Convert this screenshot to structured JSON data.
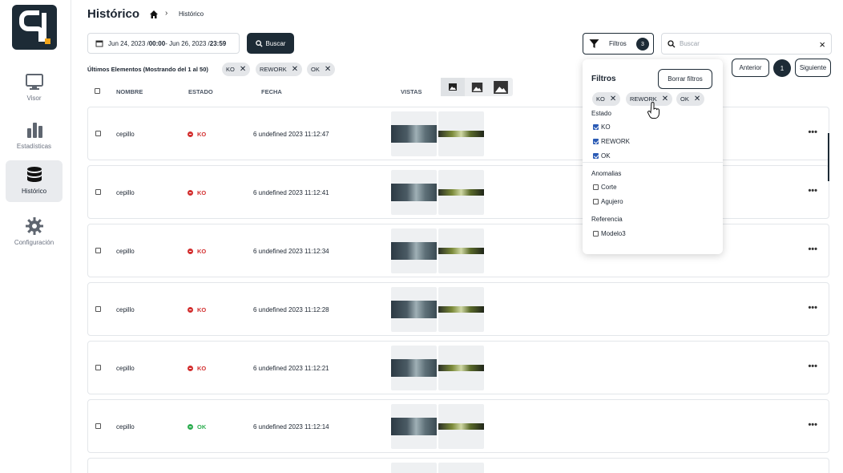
{
  "sidebar": {
    "items": [
      {
        "label": "Visor",
        "icon": "monitor-icon"
      },
      {
        "label": "Estadísticas",
        "icon": "bar-chart-icon"
      },
      {
        "label": "Histórico",
        "icon": "database-icon",
        "active": true
      },
      {
        "label": "Configuración",
        "icon": "gear-icon"
      }
    ]
  },
  "header": {
    "title": "Histórico",
    "breadcrumb_current": "Histórico"
  },
  "toolbar": {
    "date_range": "Jun 24, 2023 / 00:00 - Jun 26, 2023 / 23:59",
    "date_start": "Jun 24, 2023 / ",
    "date_start_time": "00:00",
    "date_mid": " - Jun 26, 2023 / ",
    "date_end_time": "23:59",
    "buscar_label": "Buscar",
    "filtros_label": "Filtros",
    "filtros_count": "3",
    "search_placeholder": "Buscar"
  },
  "summary": "Últimos Elementos (Mostrando del 1 al 50)",
  "active_chips": [
    "KO",
    "REWORK",
    "OK"
  ],
  "pagination": {
    "prev_label": "Anterior",
    "page": "1",
    "next_label": "Siguiente"
  },
  "table": {
    "headers": {
      "nombre": "NOMBRE",
      "estado": "ESTADO",
      "fecha": "FECHA",
      "vistas": "VISTAS"
    },
    "rows": [
      {
        "name": "cepillo",
        "status": "KO",
        "date": "6 undefined 2023 11:12:47"
      },
      {
        "name": "cepillo",
        "status": "KO",
        "date": "6 undefined 2023 11:12:41"
      },
      {
        "name": "cepillo",
        "status": "KO",
        "date": "6 undefined 2023 11:12:34"
      },
      {
        "name": "cepillo",
        "status": "KO",
        "date": "6 undefined 2023 11:12:28"
      },
      {
        "name": "cepillo",
        "status": "KO",
        "date": "6 undefined 2023 11:12:21"
      },
      {
        "name": "cepillo",
        "status": "OK",
        "date": "6 undefined 2023 11:12:14"
      }
    ]
  },
  "filter_panel": {
    "title": "Filtros",
    "clear_label": "Borrar filtros",
    "chips": [
      "KO",
      "REWORK",
      "OK"
    ],
    "sections": [
      {
        "title": "Estado",
        "options": [
          {
            "label": "KO",
            "checked": true
          },
          {
            "label": "REWORK",
            "checked": true
          },
          {
            "label": "OK",
            "checked": true
          }
        ]
      },
      {
        "title": "Anomalias",
        "options": [
          {
            "label": "Corte",
            "checked": false
          },
          {
            "label": "Agujero",
            "checked": false
          }
        ]
      },
      {
        "title": "Referencia",
        "options": [
          {
            "label": "Modelo3",
            "checked": false
          }
        ]
      }
    ]
  },
  "colors": {
    "primary": "#1d2b36",
    "ko": "#d32f2f",
    "ok": "#2fae52",
    "accent": "#f2a51a",
    "checkbox": "#2b5bb5"
  }
}
